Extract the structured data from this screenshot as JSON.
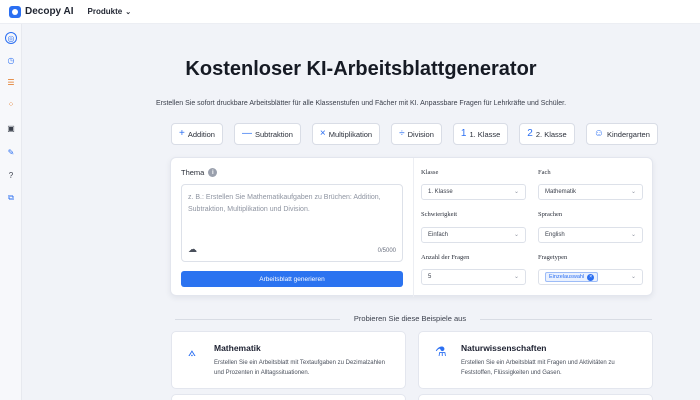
{
  "brand": {
    "name": "Decopy AI",
    "color": "#2b6ff2"
  },
  "nav": {
    "products_label": "Produkte",
    "products_icon": "chevron-down-icon"
  },
  "sidebar": {
    "icons": [
      "ai-chat-icon",
      "detector-icon",
      "list-icon",
      "grid-icon",
      "video-icon",
      "edit-icon",
      "help-icon",
      "copy-icon"
    ]
  },
  "hero": {
    "title": "Kostenloser KI-Arbeitsblattgenerator",
    "subtitle": "Erstellen Sie sofort druckbare Arbeitsblätter für alle Klassenstufen und Fächer mit KI. Anpassbare Fragen für Lehrkräfte und Schüler."
  },
  "chips": [
    {
      "icon": "+",
      "label": "Addition"
    },
    {
      "icon": "—",
      "label": "Subtraktion"
    },
    {
      "icon": "×",
      "label": "Multiplikation"
    },
    {
      "icon": "÷",
      "label": "Division"
    },
    {
      "icon": "1",
      "label": "1. Klasse"
    },
    {
      "icon": "2",
      "label": "2. Klasse"
    },
    {
      "icon": "☺",
      "label": "Kindergarten"
    }
  ],
  "form": {
    "thema_label": "Thema",
    "thema_placeholder": "z. B.: Erstellen Sie Mathematikaufgaben zu Brüchen: Addition, Subtraktion, Multiplikation und Division.",
    "counter": "0/5000",
    "generate_label": "Arbeitsblatt generieren",
    "klasse_label": "Klasse",
    "klasse_value": "1. Klasse",
    "fach_label": "Fach",
    "fach_value": "Mathematik",
    "schwierigkeit_label": "Schwierigkeit",
    "schwierigkeit_value": "Einfach",
    "sprachen_label": "Sprachen",
    "sprachen_value": "English",
    "anzahl_label": "Anzahl der Fragen",
    "anzahl_value": "5",
    "fragetypen_label": "Fragetypen",
    "fragetypen_tag": "Einzelauswahl"
  },
  "examples": {
    "heading": "Probieren Sie diese Beispiele aus",
    "cards": [
      {
        "icon": "compass-icon",
        "title": "Mathematik",
        "desc": "Erstellen Sie ein Arbeitsblatt mit Textaufgaben zu Dezimalzahlen und Prozenten in Alltagssituationen."
      },
      {
        "icon": "flask-icon",
        "title": "Naturwissenschaften",
        "desc": "Erstellen Sie ein Arbeitsblatt mit Fragen und Aktivitäten zu Feststoffen, Flüssigkeiten und Gasen."
      }
    ]
  }
}
